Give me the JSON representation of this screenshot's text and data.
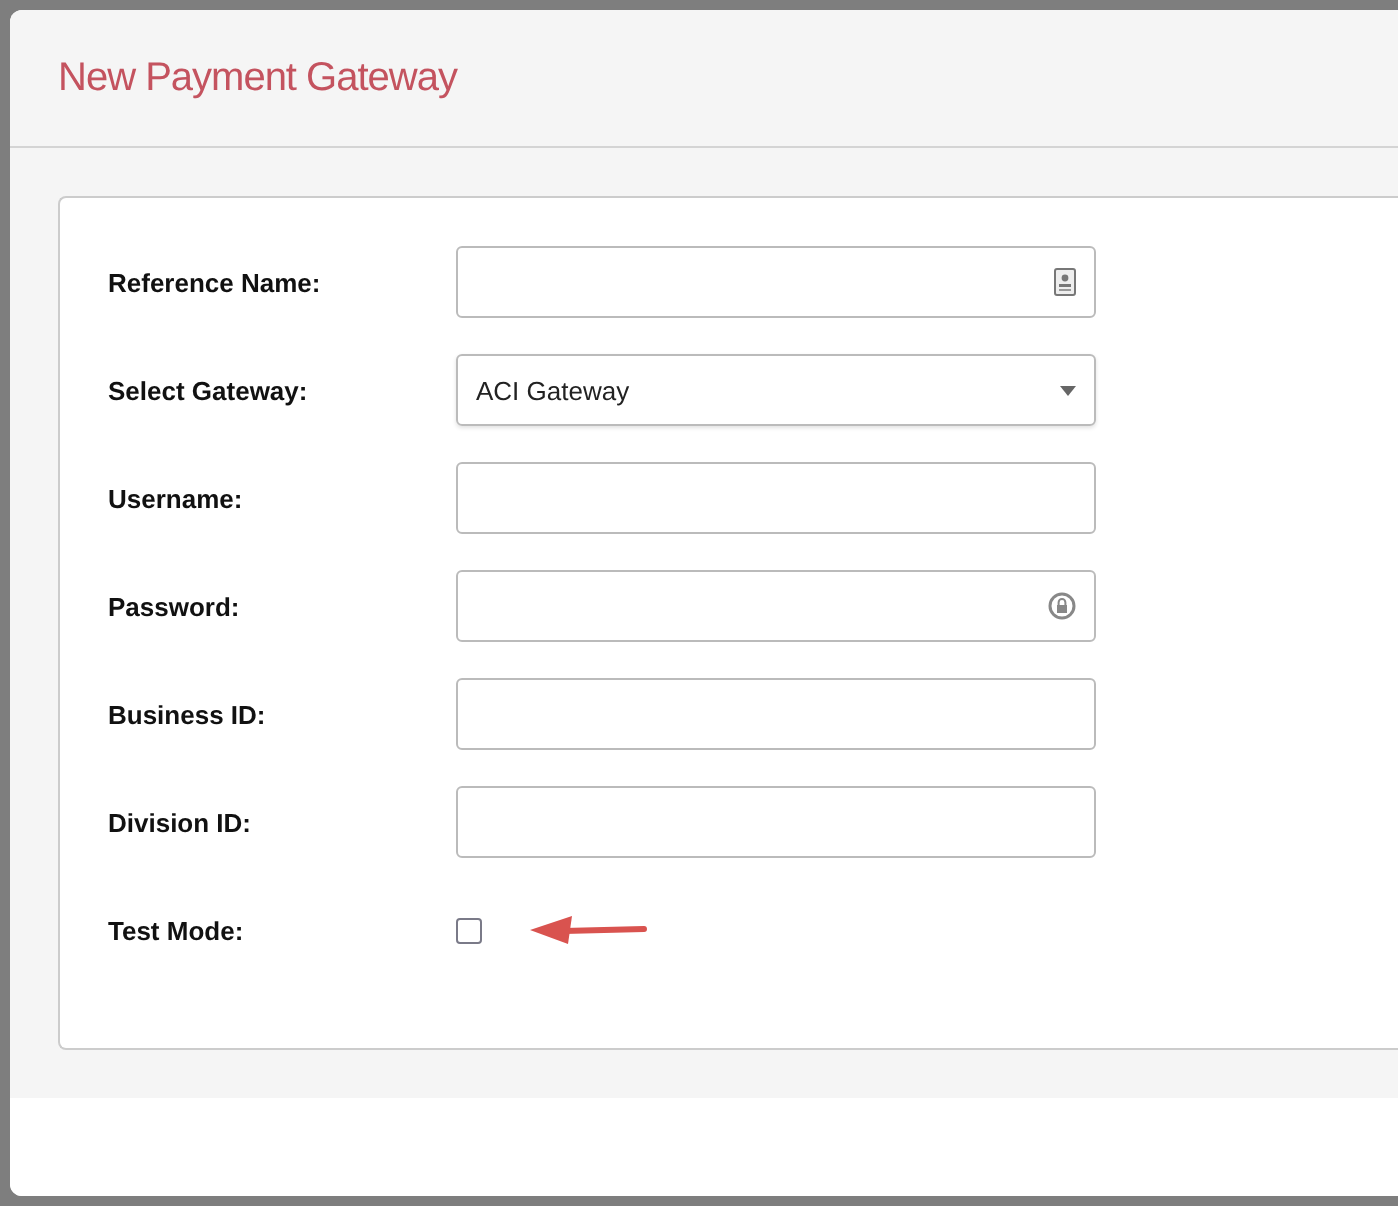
{
  "dialog": {
    "title": "New Payment Gateway"
  },
  "fields": [
    {
      "label": "Reference Name:",
      "kind": "contact"
    },
    {
      "label": "Select Gateway:",
      "kind": "select",
      "value": "ACI Gateway"
    },
    {
      "label": "Username:",
      "kind": "text"
    },
    {
      "label": "Password:",
      "kind": "password"
    },
    {
      "label": "Business ID:",
      "kind": "text"
    },
    {
      "label": "Division ID:",
      "kind": "text"
    },
    {
      "label": "Test Mode:",
      "kind": "checkbox",
      "checked": false
    }
  ]
}
